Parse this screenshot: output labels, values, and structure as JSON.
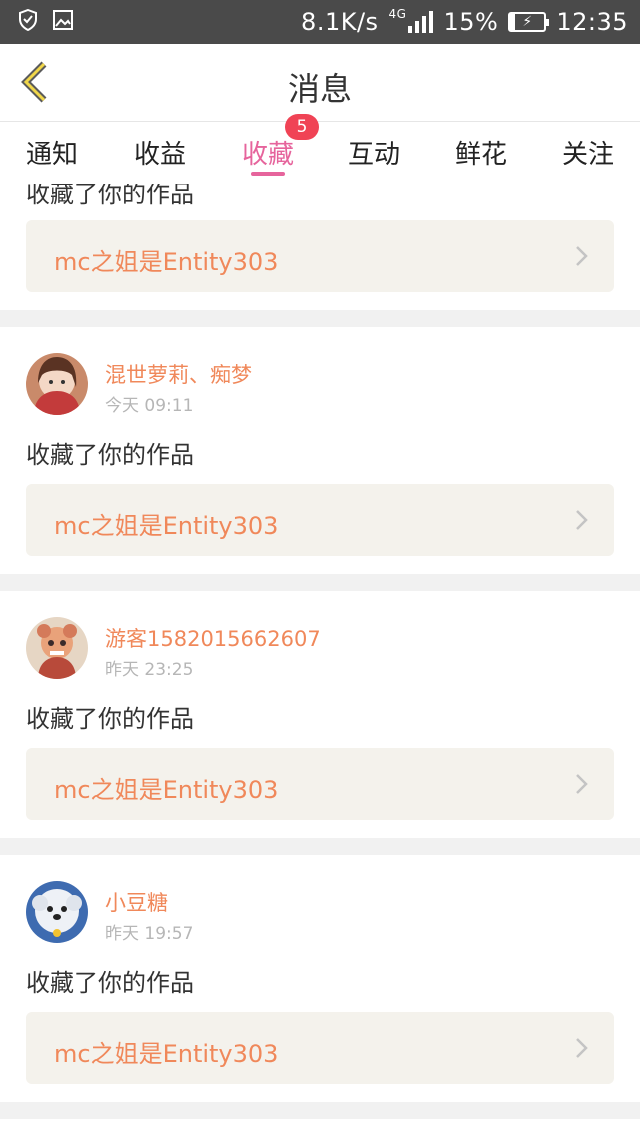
{
  "status_bar": {
    "network_speed": "8.1K/s",
    "network_type": "4G",
    "battery": "15%",
    "time": "12:35",
    "icons": [
      "shield-icon",
      "image-icon",
      "signal-icon",
      "battery-charging-icon"
    ]
  },
  "header": {
    "title": "消息",
    "back_icon": "chevron-left-icon"
  },
  "tabs": {
    "items": [
      {
        "label": "通知"
      },
      {
        "label": "收益"
      },
      {
        "label": "收藏",
        "active": true,
        "badge": "5"
      },
      {
        "label": "互动"
      },
      {
        "label": "鲜花"
      },
      {
        "label": "关注"
      }
    ]
  },
  "colors": {
    "accent": "#e6649c",
    "badge": "#f04355",
    "username": "#f0885a",
    "link_bg": "#f4f2ec"
  },
  "feed": [
    {
      "partial": true,
      "action": "收藏了你的作品",
      "work": "mc之姐是Entity303"
    },
    {
      "username": "混世萝莉、痴梦",
      "time": "今天 09:11",
      "action": "收藏了你的作品",
      "work": "mc之姐是Entity303"
    },
    {
      "username": "游客1582015662607",
      "time": "昨天 23:25",
      "action": "收藏了你的作品",
      "work": "mc之姐是Entity303"
    },
    {
      "username": "小豆糖",
      "time": "昨天 19:57",
      "action": "收藏了你的作品",
      "work": "mc之姐是Entity303"
    }
  ]
}
